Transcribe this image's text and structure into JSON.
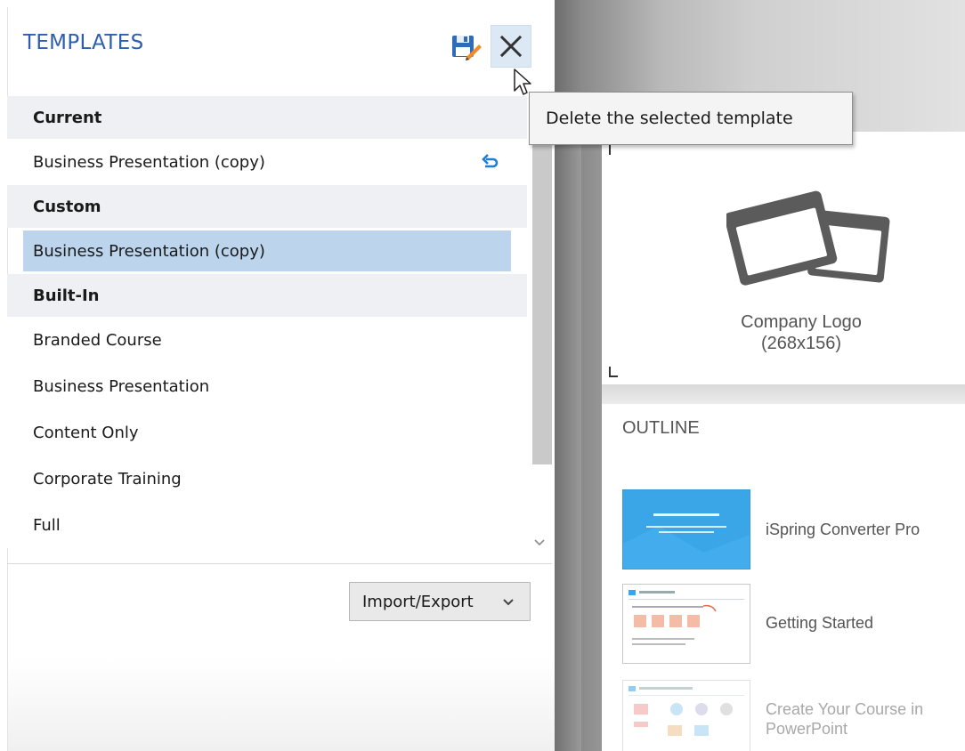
{
  "panel": {
    "title": "TEMPLATES",
    "icons": {
      "save": "save-edit-icon",
      "delete": "close-icon"
    }
  },
  "tooltip": {
    "text": "Delete the selected template"
  },
  "sections": {
    "current": {
      "label": "Current",
      "items": [
        {
          "label": "Business Presentation (copy)",
          "icon": "undo-icon"
        }
      ]
    },
    "custom": {
      "label": "Custom",
      "items": [
        {
          "label": "Business Presentation (copy)",
          "selected": true
        }
      ]
    },
    "builtin": {
      "label": "Built-In",
      "items": [
        {
          "label": "Branded Course"
        },
        {
          "label": "Business Presentation"
        },
        {
          "label": "Content Only"
        },
        {
          "label": "Corporate Training"
        },
        {
          "label": "Full"
        }
      ]
    }
  },
  "footer": {
    "import_export_label": "Import/Export"
  },
  "preview": {
    "logo_line1": "Company Logo",
    "logo_line2": "(268x156)",
    "outline_title": "OUTLINE",
    "slides": [
      {
        "label": "iSpring Converter Pro"
      },
      {
        "label": "Getting Started"
      },
      {
        "label": "Create Your Course in PowerPoint"
      }
    ]
  },
  "colors": {
    "title_blue": "#2e5eae",
    "selected_row": "#bcd4ec",
    "section_header_bg": "#eef0f3",
    "accent_blue": "#1e7fd6"
  }
}
